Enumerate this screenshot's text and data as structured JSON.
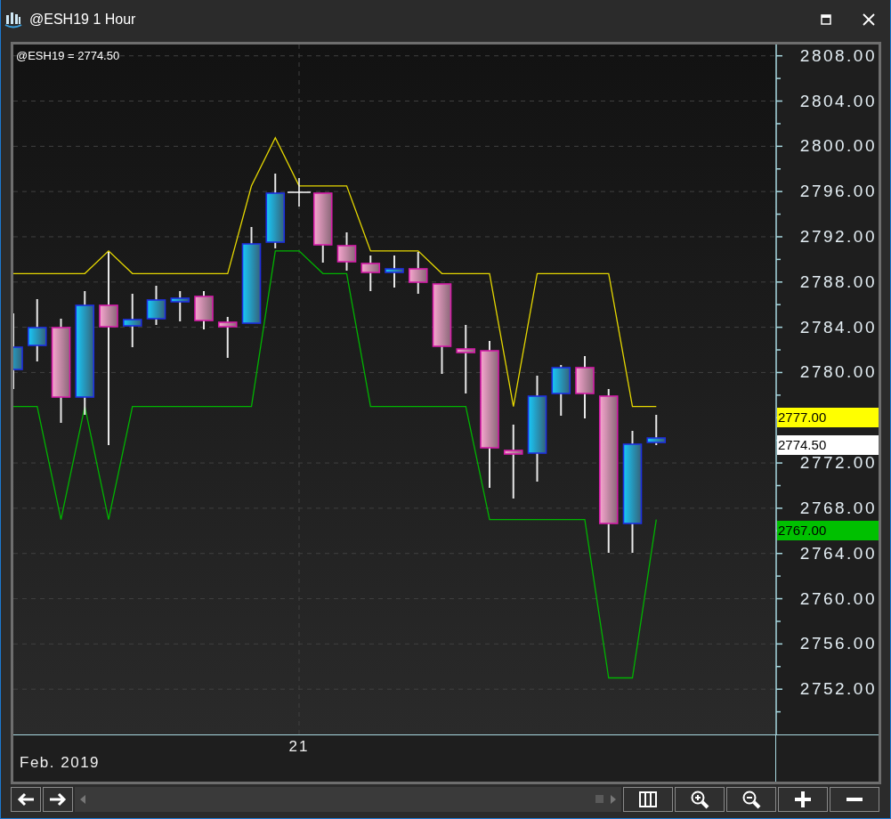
{
  "window": {
    "title": "@ESH19 1 Hour"
  },
  "chart": {
    "legend": "@ESH19 = 2774.50",
    "date_label": "21",
    "period": "Feb. 2019",
    "price_badges": [
      {
        "label": "2777.00",
        "color": "#ffff00"
      },
      {
        "label": "2774.50",
        "color": "#ffffff"
      },
      {
        "label": "2767.00",
        "color": "#00c000"
      }
    ],
    "chart_data": {
      "type": "line",
      "categories": [
        null,
        null,
        null,
        null,
        null,
        null,
        null,
        null,
        null,
        null,
        null,
        null,
        null,
        null,
        null,
        null,
        null,
        null,
        null,
        null,
        null,
        null,
        null,
        null,
        null,
        null,
        null,
        null
      ],
      "ylim": [
        2748,
        2809
      ],
      "grid": true,
      "yticks": [
        {
          "value": 2808,
          "label": "2808.00"
        },
        {
          "value": 2804,
          "label": "2804.00"
        },
        {
          "value": 2800,
          "label": "2800.00"
        },
        {
          "value": 2796,
          "label": "2796.00"
        },
        {
          "value": 2792,
          "label": "2792.00"
        },
        {
          "value": 2788,
          "label": "2788.00"
        },
        {
          "value": 2784,
          "label": "2784.00"
        },
        {
          "value": 2780,
          "label": "2780.00"
        },
        {
          "value": 2772,
          "label": "2772.00"
        },
        {
          "value": 2768,
          "label": "2768.00"
        },
        {
          "value": 2764,
          "label": "2764.00"
        },
        {
          "value": 2760,
          "label": "2760.00"
        },
        {
          "value": 2756,
          "label": "2756.00"
        },
        {
          "value": 2752,
          "label": "2752.00"
        }
      ],
      "series": [
        {
          "color": "#e6d800",
          "values": [
            2788.75,
            2788.75,
            2788.75,
            2788.75,
            2790.75,
            2788.75,
            2788.75,
            2788.75,
            2788.75,
            2788.75,
            2796.5,
            2800.75,
            2796.5,
            2796.5,
            2796.5,
            2790.75,
            2790.75,
            2790.75,
            2788.75,
            2788.75,
            2788.75,
            2777,
            2788.75,
            2788.75,
            2788.75,
            2788.75,
            2777,
            2777
          ]
        },
        {
          "color": "#00b400",
          "values": [
            2777,
            2777,
            2767,
            2777,
            2767,
            2777,
            2777,
            2777,
            2777,
            2777,
            2777,
            2790.75,
            2790.75,
            2788.75,
            2788.75,
            2777,
            2777,
            2777,
            2777,
            2777,
            2767,
            2767,
            2767,
            2767,
            2767,
            2753,
            2753,
            2767
          ]
        }
      ]
    }
  }
}
